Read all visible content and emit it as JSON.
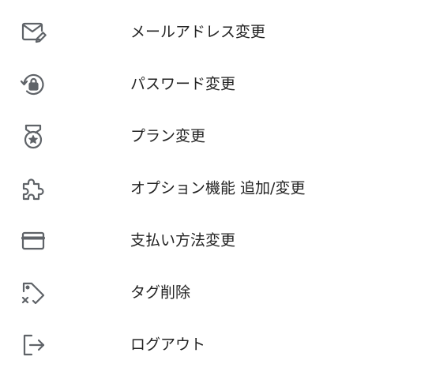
{
  "menu": {
    "items": [
      {
        "icon": "mail-edit-icon",
        "label": "メールアドレス変更"
      },
      {
        "icon": "lock-reset-icon",
        "label": "パスワード変更"
      },
      {
        "icon": "medal-icon",
        "label": "プラン変更"
      },
      {
        "icon": "puzzle-icon",
        "label": "オプション機能 追加/変更"
      },
      {
        "icon": "credit-card-icon",
        "label": "支払い方法変更"
      },
      {
        "icon": "tag-remove-icon",
        "label": "タグ削除"
      },
      {
        "icon": "logout-icon",
        "label": "ログアウト"
      }
    ]
  },
  "colors": {
    "icon": "#5f6368",
    "text": "#222222",
    "background": "#ffffff"
  }
}
